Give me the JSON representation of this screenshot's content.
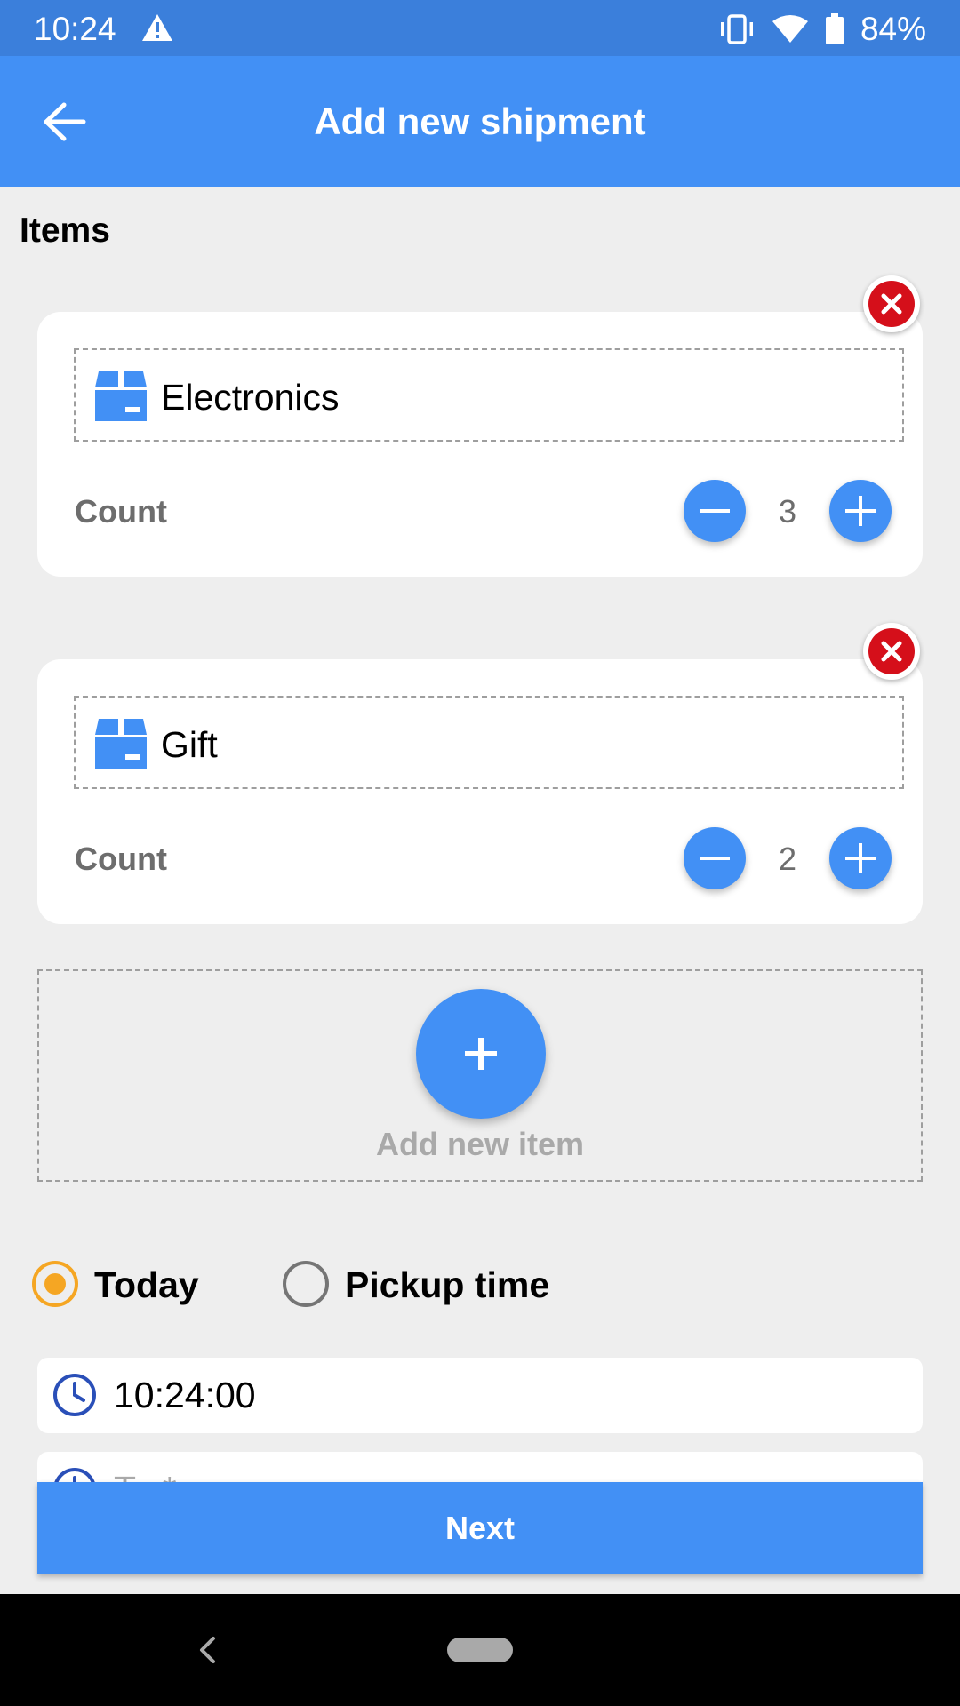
{
  "status_bar": {
    "time": "10:24",
    "battery": "84%",
    "icons": [
      "warning-icon",
      "vibrate-icon",
      "wifi-icon",
      "battery-icon"
    ]
  },
  "app_bar": {
    "title": "Add new shipment",
    "back_icon": "arrow-left-icon"
  },
  "items_section": {
    "title": "Items",
    "items": [
      {
        "name": "Electronics",
        "count_label": "Count",
        "count": "3",
        "icon": "box-icon"
      },
      {
        "name": "Gift",
        "count_label": "Count",
        "count": "2",
        "icon": "box-icon"
      }
    ],
    "add_label": "Add new item"
  },
  "pickup": {
    "options": [
      {
        "label": "Today",
        "selected": true
      },
      {
        "label": "Pickup time",
        "selected": false
      }
    ],
    "time_value": "10:24:00",
    "second_field_placeholder": "To *"
  },
  "next_label": "Next",
  "colors": {
    "primary": "#4290f5",
    "status_bar": "#3b7fdb",
    "remove": "#d50f1a",
    "radio_selected": "#f5a623"
  }
}
